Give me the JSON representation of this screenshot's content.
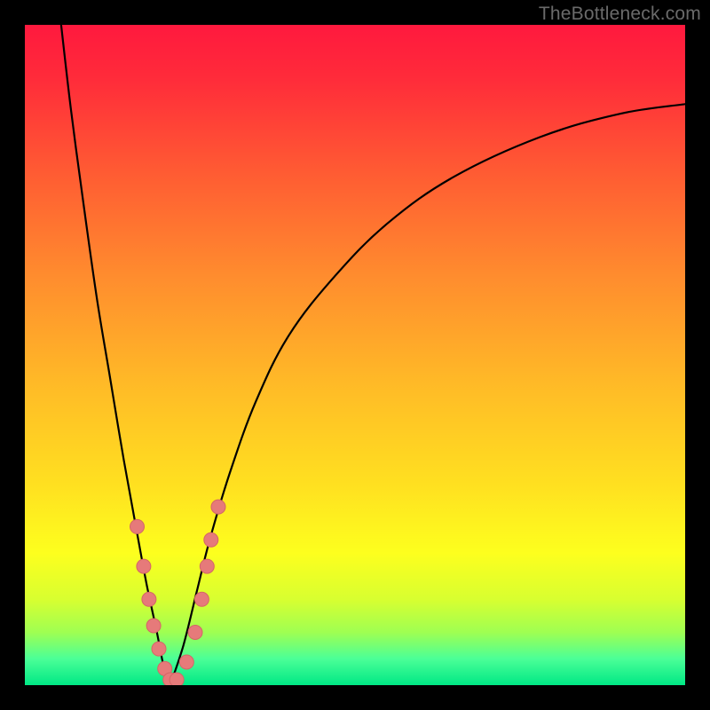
{
  "watermark": "TheBottleneck.com",
  "colors": {
    "background": "#000000",
    "curve": "#000000",
    "marker_fill": "#e67a7a",
    "marker_stroke": "#d46666"
  },
  "chart_data": {
    "type": "line",
    "title": "",
    "xlabel": "",
    "ylabel": "",
    "xlim": [
      0,
      100
    ],
    "ylim": [
      0,
      100
    ],
    "note": "V-shaped bottleneck curve; x is a relative component-balance axis, y is bottleneck percentage (0 = no bottleneck, 100 = full bottleneck). Two branches meet at the minimum near x≈22. Axis values are read approximately from the unlabeled plot.",
    "series": [
      {
        "name": "left-branch",
        "x": [
          5.5,
          7,
          9,
          11,
          13,
          15,
          17,
          18.5,
          20,
          21,
          22
        ],
        "y": [
          100,
          87,
          72,
          58,
          46,
          34,
          23,
          15,
          8,
          3,
          0
        ]
      },
      {
        "name": "right-branch",
        "x": [
          22,
          24,
          26,
          28,
          31,
          35,
          40,
          47,
          55,
          65,
          78,
          90,
          100
        ],
        "y": [
          0,
          6,
          14,
          22,
          32,
          43,
          53,
          62,
          70,
          77,
          83,
          86.5,
          88
        ]
      }
    ],
    "markers": {
      "name": "highlighted-points",
      "note": "Salmon dots clustered near the valley on both branches.",
      "points": [
        {
          "x": 17.0,
          "y": 24
        },
        {
          "x": 18.0,
          "y": 18
        },
        {
          "x": 18.8,
          "y": 13
        },
        {
          "x": 19.5,
          "y": 9
        },
        {
          "x": 20.3,
          "y": 5.5
        },
        {
          "x": 21.2,
          "y": 2.5
        },
        {
          "x": 22.0,
          "y": 0.8
        },
        {
          "x": 23.0,
          "y": 0.8
        },
        {
          "x": 24.5,
          "y": 3.5
        },
        {
          "x": 25.8,
          "y": 8
        },
        {
          "x": 26.8,
          "y": 13
        },
        {
          "x": 27.6,
          "y": 18
        },
        {
          "x": 28.2,
          "y": 22
        },
        {
          "x": 29.3,
          "y": 27
        }
      ]
    }
  }
}
